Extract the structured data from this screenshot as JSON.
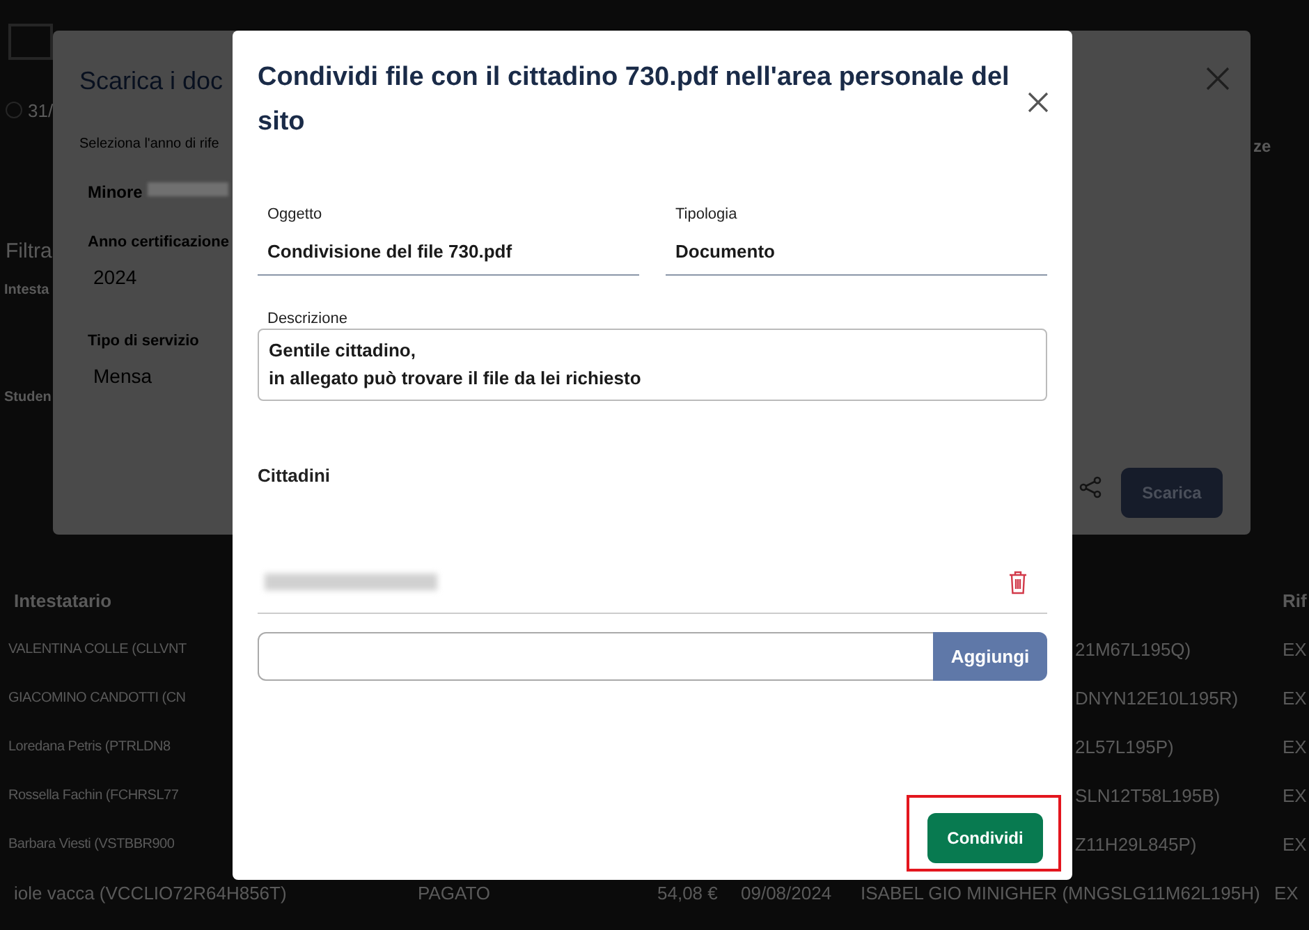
{
  "background_page": {
    "date": "31/",
    "filter_label": "Filtra",
    "field_labels": [
      "Intesta",
      "Studen"
    ],
    "column_fragment": "ze",
    "table": {
      "columns": [
        {
          "label": "Intestatario"
        }
      ],
      "reference_header": "Rif",
      "rows": [
        {
          "cells": [
            "VALENTINA COLLE (CLLVNT",
            "21M67L195Q)",
            "EX"
          ]
        },
        {
          "cells": [
            "GIACOMINO CANDOTTI (CN",
            "DNYN12E10L195R)",
            "EX"
          ]
        },
        {
          "cells": [
            "Loredana Petris (PTRLDN8",
            "2L57L195P)",
            "EX"
          ]
        },
        {
          "cells": [
            "Rossella Fachin (FCHRSL77",
            "SLN12T58L195B)",
            "EX"
          ]
        },
        {
          "cells": [
            "Barbara Viesti (VSTBBR900",
            "Z11H29L845P)",
            "EX"
          ]
        }
      ],
      "last_row": {
        "cells": [
          "iole vacca (VCCLIO72R64H856T)",
          "PAGATO",
          "54,08 €",
          "09/08/2024",
          "ISABEL GIO MINIGHER (MNGSLG11M62L195H)",
          "EX"
        ]
      }
    }
  },
  "download_dialog": {
    "title": "Scarica i doc",
    "subtitle": "Seleziona l'anno di rife",
    "minor_label": "Minore",
    "fields": [
      {
        "label": "Anno certificazione",
        "value": "2024"
      },
      {
        "label": "Tipo di servizio",
        "value": "Mensa"
      }
    ],
    "download_button": "Scarica"
  },
  "share_dialog": {
    "title": "Condividi file con il cittadino 730.pdf nell'area personale del sito",
    "fields": [
      {
        "label": "Oggetto",
        "value": "Condivisione del file 730.pdf"
      },
      {
        "label": "Tipologia",
        "value": "Documento"
      }
    ],
    "description": {
      "label": "Descrizione",
      "lines": [
        "Gentile cittadino,",
        "in allegato può trovare il file da lei richiesto"
      ]
    },
    "citizens": {
      "label": "Cittadini",
      "add_button": "Aggiungi"
    },
    "share_button": {
      "label": "Condividi",
      "highlighted": true
    }
  }
}
